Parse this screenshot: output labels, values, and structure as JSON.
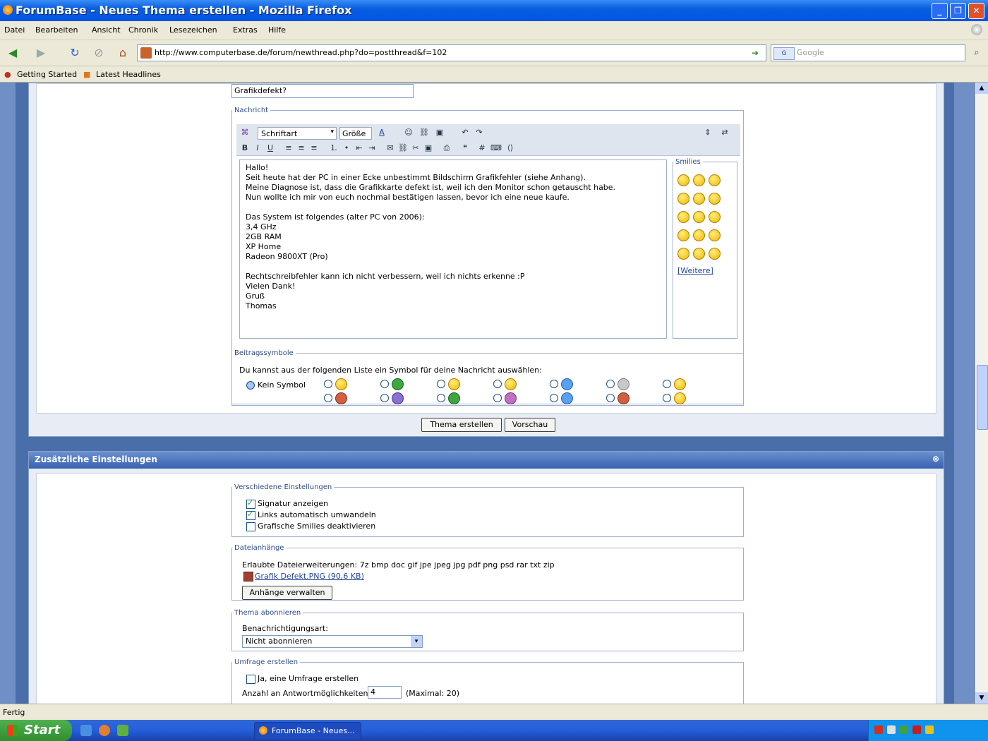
{
  "window": {
    "title": "ForumBase - Neues Thema erstellen - Mozilla Firefox"
  },
  "menu": [
    "Datei",
    "Bearbeiten",
    "Ansicht",
    "Chronik",
    "Lesezeichen",
    "Extras",
    "Hilfe"
  ],
  "nav": {
    "url": "http://www.computerbase.de/forum/newthread.php?do=postthread&f=102",
    "search_placeholder": "Google"
  },
  "bookmarks": [
    "Getting Started",
    "Latest Headlines"
  ],
  "post": {
    "title_value": "Grafikdefekt?",
    "message_legend": "Nachricht",
    "font_select": "Schriftart",
    "size_select": "Größe",
    "message_lines": [
      "Hallo!",
      "Seit heute hat der PC in einer Ecke unbestimmt Bildschirm Grafikfehler (siehe Anhang).",
      "Meine Diagnose ist, dass die Grafikkarte defekt ist, weil ich den Monitor schon getauscht habe.",
      "Nun wollte ich mir von euch nochmal bestätigen lassen, bevor ich eine neue kaufe.",
      "",
      "Das System ist folgendes (alter PC von 2006):",
      "3,4 GHz",
      "2GB RAM",
      "XP Home",
      "Radeon 9800XT (Pro)",
      "",
      "Rechtschreibfehler kann ich nicht verbessern, weil ich nichts erkenne :P",
      "Vielen Dank!",
      "Gruß",
      "Thomas"
    ],
    "smilies_legend": "Smilies",
    "smilies_more": "[Weitere]",
    "icons_legend": "Beitragssymbole",
    "icons_hint": "Du kannst aus der folgenden Liste ein Symbol für deine Nachricht auswählen:",
    "icons_none": "Kein Symbol",
    "submit_label": "Thema erstellen",
    "preview_label": "Vorschau"
  },
  "extra": {
    "header": "Zusätzliche Einstellungen",
    "misc_legend": "Verschiedene Einstellungen",
    "misc_options": [
      {
        "label": "Signatur anzeigen",
        "checked": true
      },
      {
        "label": "Links automatisch umwandeln",
        "checked": true
      },
      {
        "label": "Grafische Smilies deaktivieren",
        "checked": false
      }
    ],
    "attach_legend": "Dateianhänge",
    "attach_types": "Erlaubte Dateierweiterungen: 7z bmp doc gif jpe jpeg jpg pdf png psd rar txt zip",
    "attach_file": "Grafik Defekt.PNG (90,6 KB)",
    "attach_button": "Anhänge verwalten",
    "sub_legend": "Thema abonnieren",
    "sub_label": "Benachrichtigungsart:",
    "sub_value": "Nicht abonnieren",
    "poll_legend": "Umfrage erstellen",
    "poll_check": "Ja, eine Umfrage erstellen",
    "poll_count_label": "Anzahl an Antwortmöglichkeiten:",
    "poll_count_value": "4",
    "poll_max": "(Maximal: 20)"
  },
  "status": {
    "text": "Fertig"
  },
  "taskbar": {
    "start": "Start",
    "task": "ForumBase - Neues..."
  }
}
